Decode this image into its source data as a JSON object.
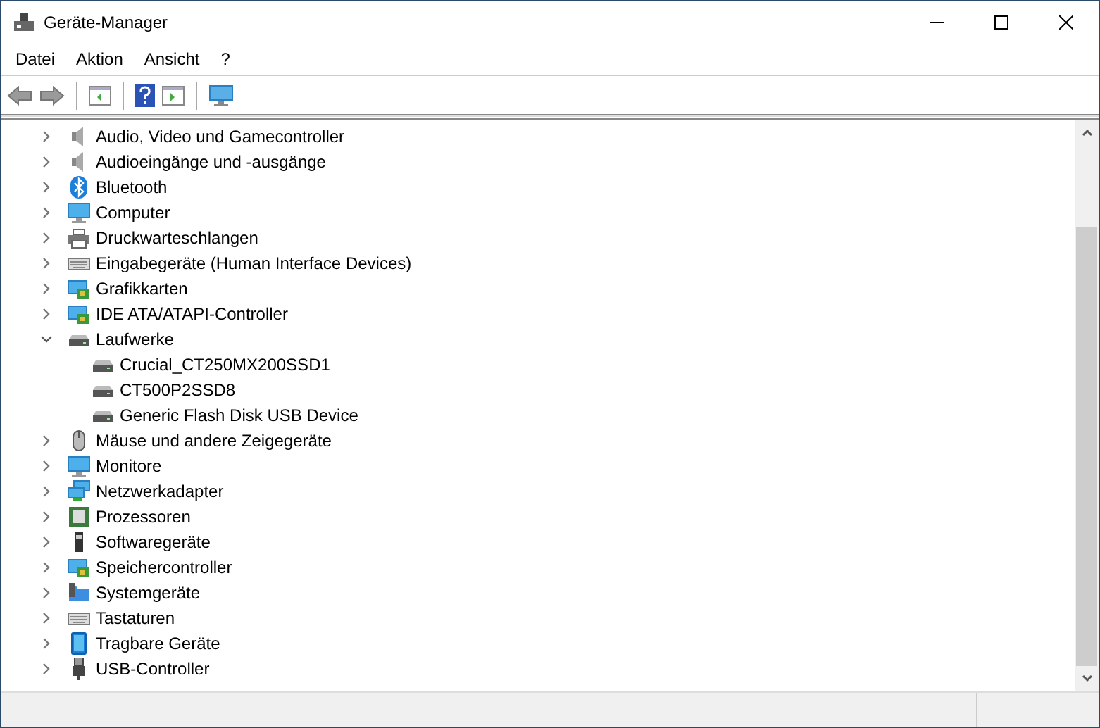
{
  "window": {
    "title": "Geräte-Manager"
  },
  "menu": [
    "Datei",
    "Aktion",
    "Ansicht",
    "?"
  ],
  "tree": [
    {
      "label": "Audio, Video und Gamecontroller",
      "expanded": false
    },
    {
      "label": "Audioeingänge und -ausgänge",
      "expanded": false
    },
    {
      "label": "Bluetooth",
      "expanded": false
    },
    {
      "label": "Computer",
      "expanded": false
    },
    {
      "label": "Druckwarteschlangen",
      "expanded": false
    },
    {
      "label": "Eingabegeräte (Human Interface Devices)",
      "expanded": false
    },
    {
      "label": "Grafikkarten",
      "expanded": false
    },
    {
      "label": "IDE ATA/ATAPI-Controller",
      "expanded": false
    },
    {
      "label": "Laufwerke",
      "expanded": true,
      "children": [
        {
          "label": "Crucial_CT250MX200SSD1"
        },
        {
          "label": "CT500P2SSD8"
        },
        {
          "label": "Generic Flash Disk USB Device"
        }
      ]
    },
    {
      "label": "Mäuse und andere Zeigegeräte",
      "expanded": false
    },
    {
      "label": "Monitore",
      "expanded": false
    },
    {
      "label": "Netzwerkadapter",
      "expanded": false
    },
    {
      "label": "Prozessoren",
      "expanded": false
    },
    {
      "label": "Softwaregeräte",
      "expanded": false
    },
    {
      "label": "Speichercontroller",
      "expanded": false
    },
    {
      "label": "Systemgeräte",
      "expanded": false
    },
    {
      "label": "Tastaturen",
      "expanded": false
    },
    {
      "label": "Tragbare Geräte",
      "expanded": false
    },
    {
      "label": "USB-Controller",
      "expanded": false
    }
  ]
}
